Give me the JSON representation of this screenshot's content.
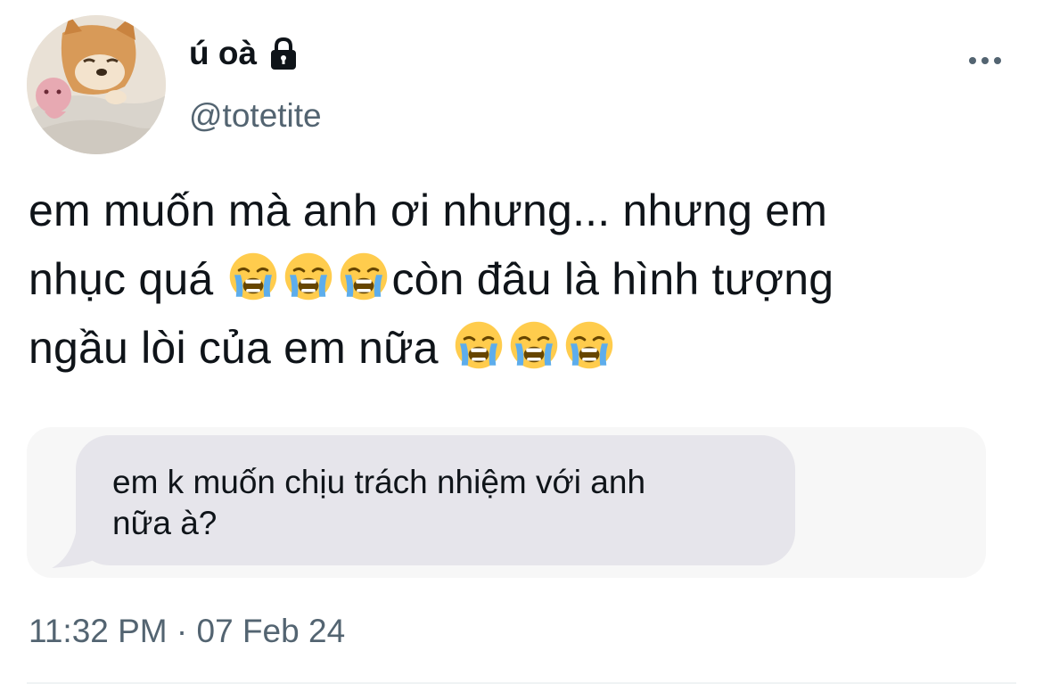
{
  "user": {
    "display_name": "ú oà",
    "handle": "@totetite",
    "lock_icon": "lock-icon",
    "avatar": "shiba-dog-avatar"
  },
  "menu": {
    "more_icon": "more-options-icon"
  },
  "tweet": {
    "line_1": "em muốn mà anh ơi nhưng... nhưng em",
    "line_2_start": "nhục quá ",
    "line_2_end": "còn đâu là hình tượng",
    "line_3": "ngầu lòi của em nữa ",
    "emoji_name": "loudly-crying-face-emoji"
  },
  "attached_message": {
    "text": "em k muốn chịu trách nhiệm với anh\nnữa à?"
  },
  "meta": {
    "time": "11:32 PM",
    "separator": "·",
    "date": "07 Feb 24"
  },
  "colors": {
    "text_primary": "#0f1419",
    "text_secondary": "#536471",
    "bubble": "#e6e5eb",
    "image_background": "#f7f7f7"
  }
}
